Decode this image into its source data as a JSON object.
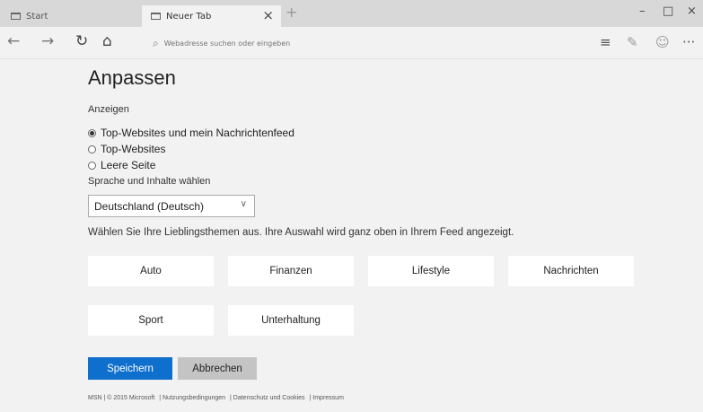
{
  "browser": {
    "tabs": [
      {
        "label": "Start"
      },
      {
        "label": "Neuer Tab"
      }
    ],
    "new_tab_symbol": "+",
    "close_symbol": "×",
    "window_controls": {
      "minimize": "–",
      "maximize": "□",
      "close": "×"
    },
    "toolbar": {
      "back": "←",
      "forward": "→",
      "refresh": "↻",
      "home": "⌂",
      "address_placeholder": "Webadresse suchen oder eingeben",
      "icons": [
        "reading-list-icon",
        "notes-icon",
        "share-icon",
        "more-icon"
      ],
      "more": "···"
    }
  },
  "page": {
    "title": "Anpassen",
    "display_label": "Anzeigen",
    "display_options": [
      {
        "label": "Top-Websites und mein Nachrichtenfeed",
        "selected": true
      },
      {
        "label": "Top-Websites",
        "selected": false
      },
      {
        "label": "Leere Seite",
        "selected": false
      }
    ],
    "language_label": "Sprache und Inhalte wählen",
    "language_value": "Deutschland (Deutsch)",
    "topics_hint": "Wählen Sie Ihre Lieblingsthemen aus. Ihre Auswahl wird ganz oben in Ihrem Feed angezeigt.",
    "topics": [
      "Auto",
      "Finanzen",
      "Lifestyle",
      "Nachrichten",
      "Sport",
      "Unterhaltung"
    ],
    "save_label": "Speichern",
    "cancel_label": "Abbrechen",
    "footer": [
      "MSN | © 2015 Microsoft",
      "| Nutzungsbedingungen",
      "| Datenschutz und Cookies",
      "| Impressum"
    ]
  },
  "colors": {
    "accent": "#0f6fcc",
    "background": "#f2f2f2"
  }
}
